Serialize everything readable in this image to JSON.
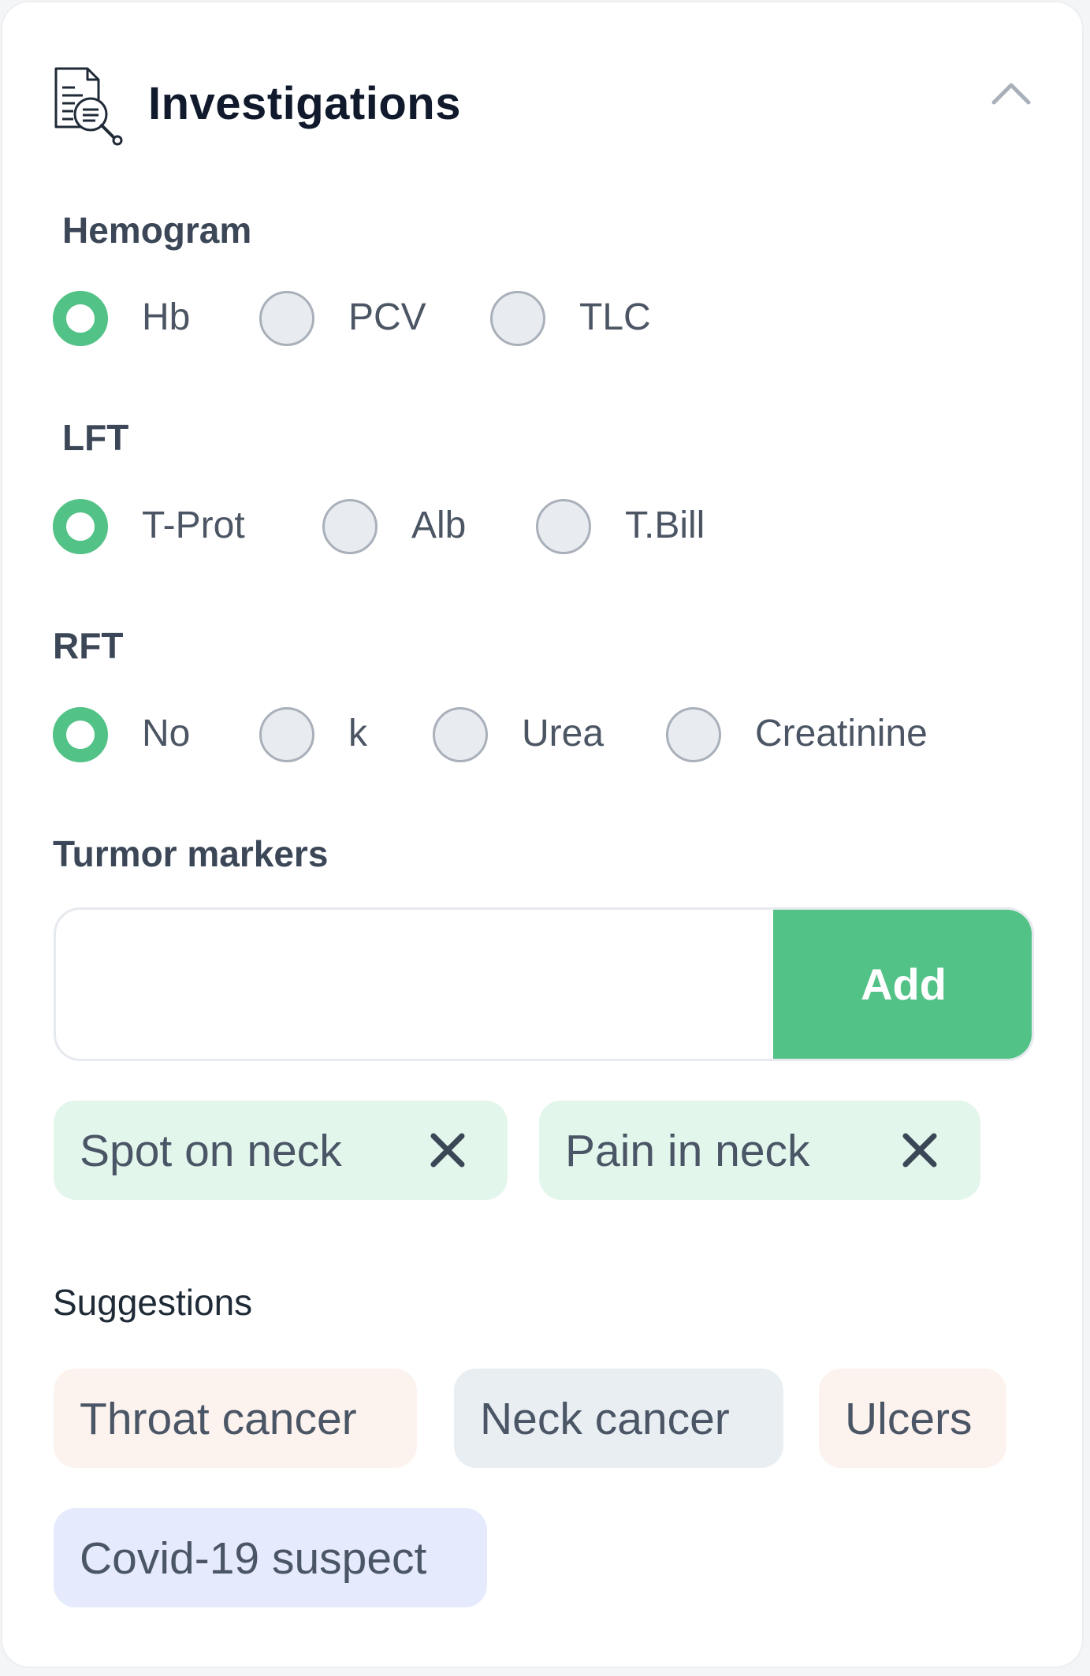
{
  "header": {
    "title": "Investigations",
    "icon": "document-search-icon",
    "collapse_icon": "chevron-up-icon"
  },
  "sections": {
    "hemogram": {
      "label": "Hemogram",
      "options": [
        {
          "label": "Hb",
          "checked": true
        },
        {
          "label": "PCV",
          "checked": false
        },
        {
          "label": "TLC",
          "checked": false
        }
      ]
    },
    "lft": {
      "label": "LFT",
      "options": [
        {
          "label": "T-Prot",
          "checked": true
        },
        {
          "label": "Alb",
          "checked": false
        },
        {
          "label": "T.Bill",
          "checked": false
        }
      ]
    },
    "rft": {
      "label": "RFT",
      "options": [
        {
          "label": "No",
          "checked": true
        },
        {
          "label": "k",
          "checked": false
        },
        {
          "label": "Urea",
          "checked": false
        },
        {
          "label": "Creatinine",
          "checked": false
        }
      ]
    }
  },
  "tumor_markers": {
    "label": "Turmor markers",
    "input_value": "",
    "add_label": "Add",
    "tags": [
      {
        "label": "Spot on neck",
        "remove_icon": "close-icon"
      },
      {
        "label": "Pain in neck",
        "remove_icon": "close-icon"
      }
    ]
  },
  "suggestions": {
    "label": "Suggestions",
    "items": [
      {
        "label": "Throat cancer",
        "color": "#fdf3ee"
      },
      {
        "label": "Neck cancer",
        "color": "#e9eef2"
      },
      {
        "label": "Ulcers",
        "color": "#fdf3ee"
      },
      {
        "label": "Covid-19 suspect",
        "color": "#e5eafc"
      }
    ]
  },
  "colors": {
    "accent": "#52c287",
    "tag_bg": "#e3f6ec",
    "radio_unchecked": "#e8ecf1"
  }
}
